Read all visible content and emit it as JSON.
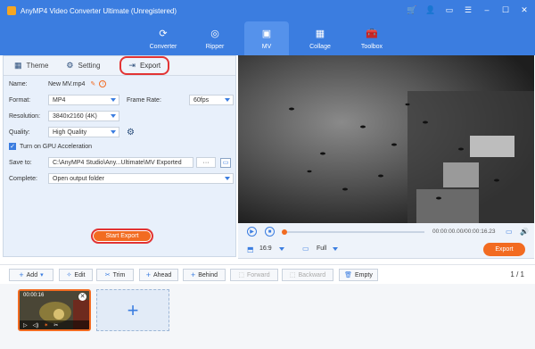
{
  "app": {
    "title": "AnyMP4 Video Converter Ultimate (Unregistered)",
    "accent": "#3b7de0",
    "orange": "#f26b21"
  },
  "nav": {
    "tabs": [
      {
        "label": "Converter",
        "icon": "converter-icon"
      },
      {
        "label": "Ripper",
        "icon": "ripper-icon"
      },
      {
        "label": "MV",
        "icon": "mv-icon"
      },
      {
        "label": "Collage",
        "icon": "collage-icon"
      },
      {
        "label": "Toolbox",
        "icon": "toolbox-icon"
      }
    ],
    "active": "MV"
  },
  "panel": {
    "tabs": {
      "theme": "Theme",
      "setting": "Setting",
      "export": "Export"
    },
    "name_label": "Name:",
    "name_value": "New MV.mp4",
    "format_label": "Format:",
    "format_value": "MP4",
    "framerate_label": "Frame Rate:",
    "framerate_value": "60fps",
    "resolution_label": "Resolution:",
    "resolution_value": "3840x2160 (4K)",
    "quality_label": "Quality:",
    "quality_value": "High Quality",
    "gpu_label": "Turn on GPU Acceleration",
    "saveto_label": "Save to:",
    "saveto_value": "C:\\AnyMP4 Studio\\Any...Ultimate\\MV Exported",
    "browse_label": "···",
    "complete_label": "Complete:",
    "complete_value": "Open output folder",
    "start_export": "Start Export"
  },
  "player": {
    "timecode": "00:00:00.00/00:00:16.23",
    "ratio": "16:9",
    "zoom": "Full",
    "export": "Export"
  },
  "toolbar": {
    "add": "Add",
    "edit": "Edit",
    "trim": "Trim",
    "ahead": "Ahead",
    "behind": "Behind",
    "forward": "Forward",
    "backward": "Backward",
    "empty": "Empty",
    "page": "1 / 1"
  },
  "timeline": {
    "clip_time": "00:00:16"
  }
}
